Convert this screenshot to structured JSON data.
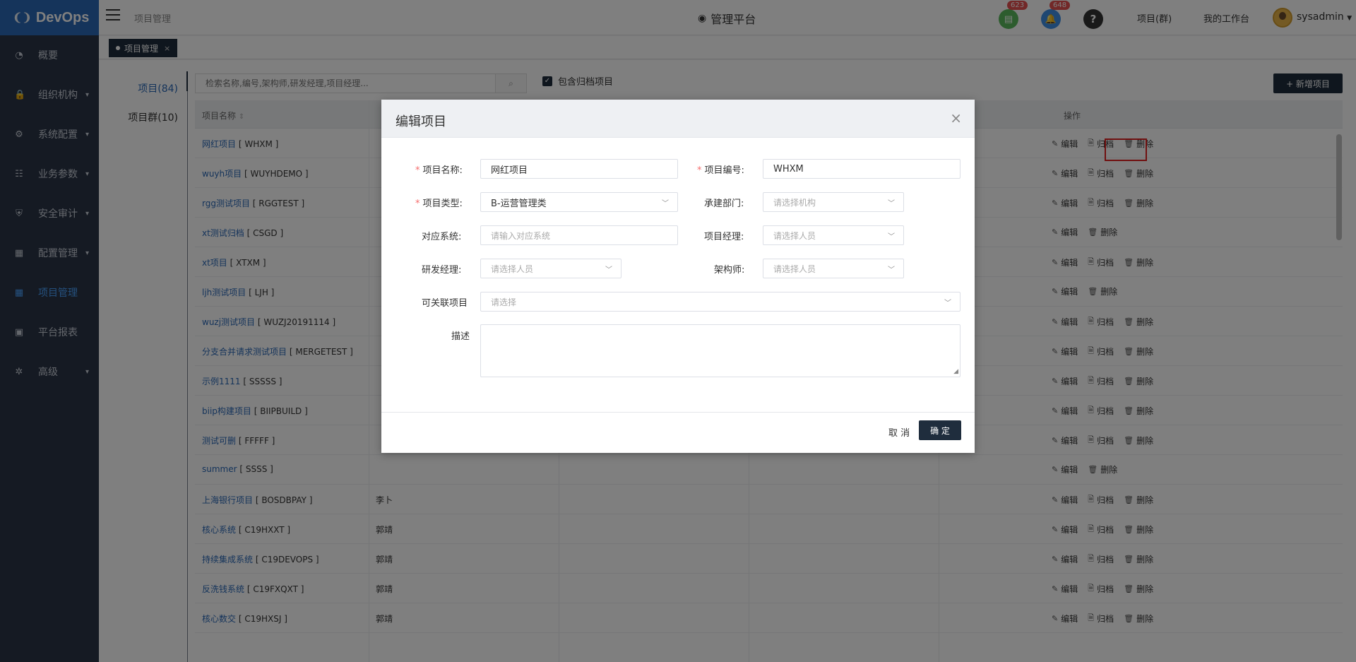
{
  "header": {
    "logo": "DevOps",
    "breadcrumb": "项目管理",
    "platform": "管理平台",
    "badge_doc": "623",
    "badge_bell": "648",
    "link_group": "项目(群)",
    "link_workspace": "我的工作台",
    "user": "sysadmin"
  },
  "sidebar": {
    "items": [
      {
        "label": "概要",
        "icon": "dashboard-icon"
      },
      {
        "label": "组织机构",
        "icon": "lock-icon"
      },
      {
        "label": "系统配置",
        "icon": "gear-icon"
      },
      {
        "label": "业务参数",
        "icon": "sliders-icon"
      },
      {
        "label": "安全审计",
        "icon": "shield-icon"
      },
      {
        "label": "配置管理",
        "icon": "database-icon"
      },
      {
        "label": "项目管理",
        "icon": "grid-icon"
      },
      {
        "label": "平台报表",
        "icon": "monitor-icon"
      },
      {
        "label": "高级",
        "icon": "cogs-icon"
      }
    ]
  },
  "tabs": {
    "active": "项目管理"
  },
  "leftnav": {
    "projects": "项目(84)",
    "groups": "项目群(10)"
  },
  "toolbar": {
    "search_placeholder": "检索名称,编号,架构师,研发经理,项目经理...",
    "include_archived": "包含归档项目",
    "add_button": "+ 新增项目"
  },
  "table": {
    "col_name": "项目名称",
    "col_ops": "操作",
    "rows": [
      {
        "name": "网红项目",
        "code": "[ WHXM ]",
        "owner": "",
        "archive": true
      },
      {
        "name": "wuyh项目",
        "code": "[ WUYHDEMO ]",
        "owner": "",
        "archive": true
      },
      {
        "name": "rgg测试项目",
        "code": "[ RGGTEST ]",
        "owner": "",
        "archive": true
      },
      {
        "name": "xt测试归档",
        "code": "[ CSGD ]",
        "owner": "",
        "archive": false
      },
      {
        "name": "xt项目",
        "code": "[ XTXM ]",
        "owner": "",
        "archive": true
      },
      {
        "name": "ljh测试项目",
        "code": "[ LJH ]",
        "owner": "",
        "archive": false
      },
      {
        "name": "wuzj测试项目",
        "code": "[ WUZJ20191114 ]",
        "owner": "",
        "archive": true
      },
      {
        "name": "分支合并请求测试项目",
        "code": "[ MERGETEST ]",
        "owner": "",
        "archive": true
      },
      {
        "name": "示例1111",
        "code": "[ SSSSS ]",
        "owner": "",
        "archive": true
      },
      {
        "name": "biip构建项目",
        "code": "[ BIIPBUILD ]",
        "owner": "",
        "archive": true
      },
      {
        "name": "测试可删",
        "code": "[ FFFFF ]",
        "owner": "",
        "archive": true
      },
      {
        "name": "summer",
        "code": "[ SSSS ]",
        "owner": "",
        "archive": false
      },
      {
        "name": "上海银行项目",
        "code": "[ BOSDBPAY ]",
        "owner": "李卜",
        "archive": true
      },
      {
        "name": "核心系统",
        "code": "[ C19HXXT ]",
        "owner": "郭靖",
        "archive": true
      },
      {
        "name": "持续集成系统",
        "code": "[ C19DEVOPS ]",
        "owner": "郭靖",
        "archive": true
      },
      {
        "name": "反洗钱系统",
        "code": "[ C19FXQXT ]",
        "owner": "郭靖",
        "archive": true
      },
      {
        "name": "核心数交",
        "code": "[ C19HXSJ ]",
        "owner": "郭靖",
        "archive": true
      }
    ],
    "act_edit": "编辑",
    "act_archive": "归档",
    "act_delete": "删除"
  },
  "modal": {
    "title": "编辑项目",
    "name_label": "项目名称:",
    "name_value": "网红项目",
    "code_label": "项目编号:",
    "code_value": "WHXM",
    "type_label": "项目类型:",
    "type_value": "B-运营管理类",
    "dept_label": "承建部门:",
    "dept_placeholder": "请选择机构",
    "system_label": "对应系统:",
    "system_placeholder": "请输入对应系统",
    "pm_label": "项目经理:",
    "pm_placeholder": "请选择人员",
    "dev_label": "研发经理:",
    "dev_placeholder": "请选择人员",
    "arch_label": "架构师:",
    "arch_placeholder": "请选择人员",
    "related_label": "可关联项目",
    "related_placeholder": "请选择",
    "desc_label": "描述",
    "cancel": "取 消",
    "ok": "确 定"
  }
}
